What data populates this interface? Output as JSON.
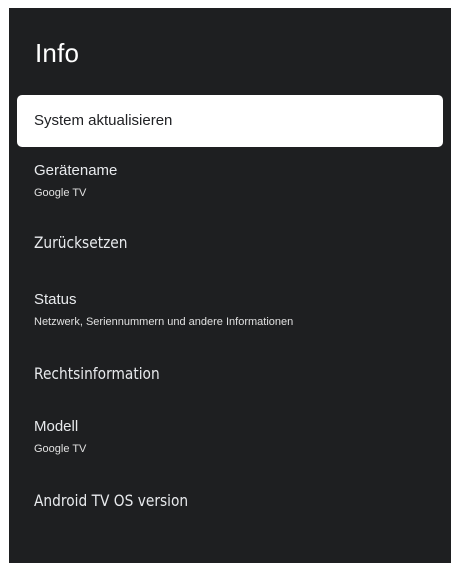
{
  "screen": {
    "title": "Info"
  },
  "items": [
    {
      "label": "System aktualisieren",
      "sub": ""
    },
    {
      "label": "Gerätename",
      "sub": "Google TV"
    },
    {
      "label": "Zurücksetzen",
      "sub": ""
    },
    {
      "label": "Status",
      "sub": "Netzwerk, Seriennummern und andere Informationen"
    },
    {
      "label": "Rechtsinformation",
      "sub": ""
    },
    {
      "label": "Modell",
      "sub": "Google TV"
    },
    {
      "label": "Android TV OS version",
      "sub": ""
    }
  ],
  "colors": {
    "background": "#1e1f21",
    "focus": "#ffffff",
    "text": "#e8eaed"
  }
}
